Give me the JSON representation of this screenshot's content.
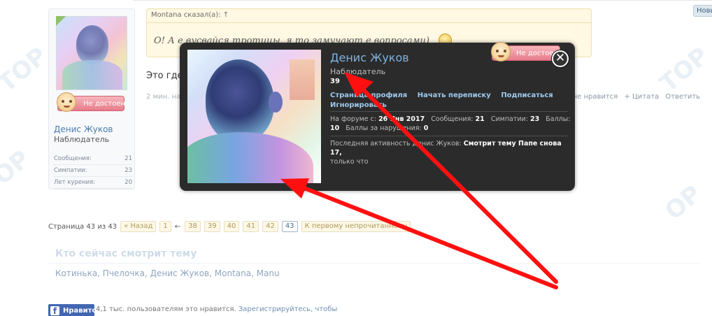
{
  "header": {
    "new_button": "Новы"
  },
  "user_card": {
    "name": "Денис Жуков",
    "role": "Наблюдатель",
    "badge": "Не достоен",
    "stats": [
      {
        "label": "Сообщения:",
        "value": "21"
      },
      {
        "label": "Симпатии:",
        "value": "23"
      },
      {
        "label": "Лет курения:",
        "value": "20"
      }
    ]
  },
  "quote": {
    "header": "Montana сказал(а): ↑",
    "text": "О! А е вусвайся тротицы, я то замучают е вопросами)"
  },
  "post": {
    "text": "Это где",
    "meta": "2 мин. на",
    "actions": [
      "Мне нравится",
      "+ Цитата",
      "Ответить"
    ]
  },
  "pagination": {
    "label": "Страница 43 из 43",
    "prev": "« Назад",
    "first": "1",
    "ellipsis": "←",
    "pages": [
      "38",
      "39",
      "40",
      "41",
      "42"
    ],
    "current": "43",
    "unread": "К первому непрочитанному"
  },
  "viewers": {
    "title": "Кто сейчас смотрит тему",
    "list": "Котинька, Пчелочка, Денис Жуков, Montana, Manu"
  },
  "facebook": {
    "button": "Нравится",
    "text": "4,1 тыс. пользователям это нравится.",
    "link": "Зарегистрируйтесь, чтобы"
  },
  "popup": {
    "name": "Денис Жуков",
    "role": "Наблюдатель",
    "id": "39",
    "badge": "Не достоен",
    "links": [
      "Страница профиля",
      "Начать переписку",
      "Подписаться",
      "Игнорировать"
    ],
    "joined_label": "На форуме с:",
    "joined_value": "26 Янв 2017",
    "messages_label": "Сообщения:",
    "messages_value": "21",
    "likes_label": "Симпатии:",
    "likes_value": "23",
    "points_label": "Баллы:",
    "points_value": "10",
    "violation_label": "Баллы за нарушения:",
    "violation_value": "0",
    "activity_label": "Последняя активность Денис Жуков:",
    "activity_value": "Смотрит тему Папе снова 17,",
    "activity_tail": "только что"
  },
  "colors": {
    "accent": "#4a7bb0",
    "popup_bg": "#2b2b2b",
    "annotation_arrow": "#ff0000"
  }
}
